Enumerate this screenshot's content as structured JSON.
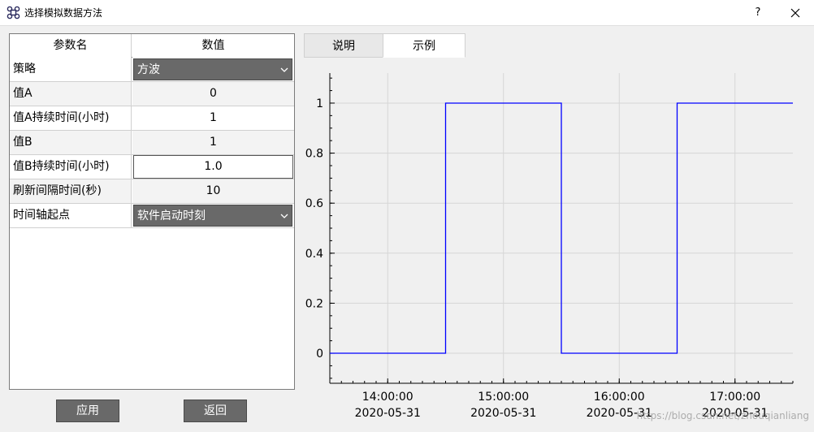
{
  "window": {
    "title": "选择模拟数据方法",
    "help_label": "?"
  },
  "table": {
    "headers": [
      "参数名",
      "数值"
    ],
    "rows": [
      {
        "name": "策略",
        "value": "方波",
        "editor": "combo"
      },
      {
        "name": "值A",
        "value": "0",
        "editor": "text"
      },
      {
        "name": "值A持续时间(小时)",
        "value": "1",
        "editor": "text"
      },
      {
        "name": "值B",
        "value": "1",
        "editor": "text"
      },
      {
        "name": "值B持续时间(小时)",
        "value": "1.0",
        "editor": "editing"
      },
      {
        "name": "刷新间隔时间(秒)",
        "value": "10",
        "editor": "text"
      },
      {
        "name": "时间轴起点",
        "value": "软件启动时刻",
        "editor": "combo"
      }
    ]
  },
  "buttons": {
    "apply": "应用",
    "back": "返回"
  },
  "tabs": [
    {
      "label": "说明",
      "active": false
    },
    {
      "label": "示例",
      "active": true
    }
  ],
  "chart_data": {
    "type": "line",
    "series": [
      {
        "color": "#0000ff",
        "x": [
          "13:30:00",
          "14:30:00",
          "14:30:00",
          "15:30:00",
          "15:30:00",
          "16:30:00",
          "16:30:00",
          "17:30:00"
        ],
        "values": [
          0,
          0,
          1,
          1,
          0,
          0,
          1,
          1
        ]
      }
    ],
    "x_range": [
      "2020-05-31 13:30:00",
      "2020-05-31 17:30:00"
    ],
    "x_ticks": [
      {
        "time": "14:00:00",
        "date": "2020-05-31"
      },
      {
        "time": "15:00:00",
        "date": "2020-05-31"
      },
      {
        "time": "16:00:00",
        "date": "2020-05-31"
      },
      {
        "time": "17:00:00",
        "date": "2020-05-31"
      }
    ],
    "y_ticks": [
      "0",
      "0.2",
      "0.4",
      "0.6",
      "0.8",
      "1"
    ],
    "ylim": [
      -0.12,
      1.12
    ],
    "grid": true,
    "title": "",
    "xlabel": "",
    "ylabel": ""
  },
  "watermark": "https://blog.csdn.net/zhouqianliang"
}
